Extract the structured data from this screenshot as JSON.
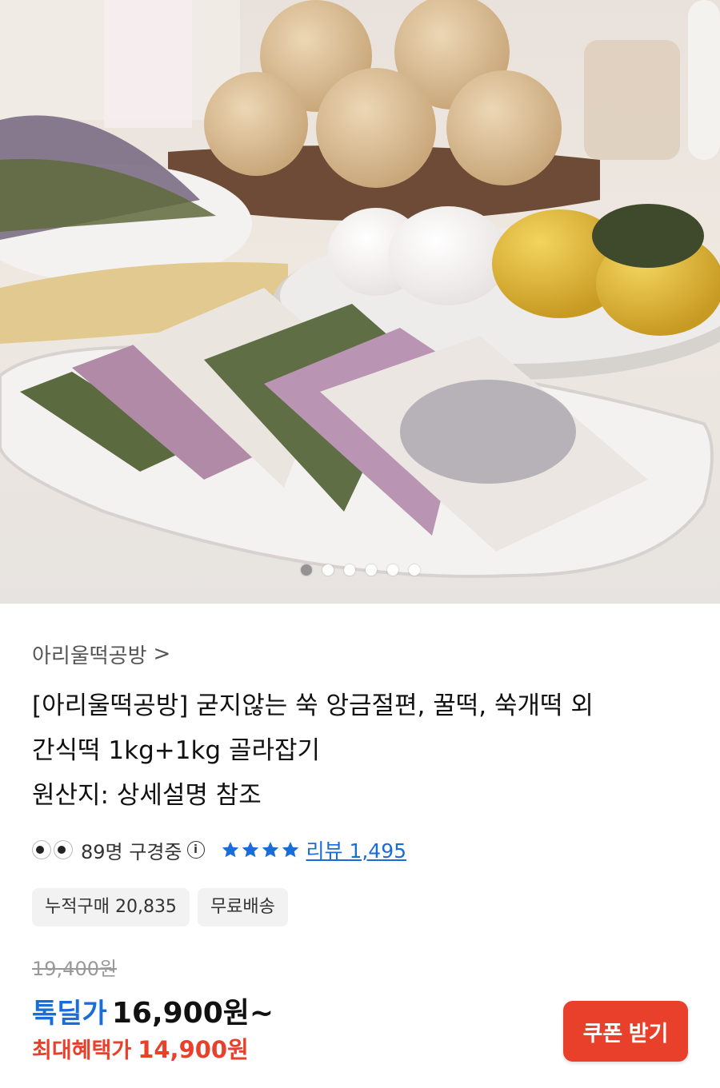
{
  "gallery": {
    "slide_count": 6,
    "active_index": 0
  },
  "seller": {
    "name": "아리울떡공방",
    "chevron": ">"
  },
  "product": {
    "title_line1": "[아리울떡공방] 굳지않는 쑥 앙금절편, 꿀떡, 쑥개떡 외",
    "title_line2": "간식떡 1kg+1kg 골라잡기",
    "origin": "원산지: 상세설명 참조"
  },
  "meta": {
    "watching": "89명 구경중",
    "info_icon": "ⓘ",
    "rating_stars": 4,
    "review_link": "리뷰 1,495"
  },
  "badges": [
    "누적구매 20,835",
    "무료배송"
  ],
  "pricing": {
    "original_price": "19,400원",
    "deal_label": "톡딜가",
    "deal_price": "16,900원~",
    "max_benefit_label": "최대혜택가",
    "max_benefit_price": "14,900원",
    "coupon_button": "쿠폰 받기"
  },
  "colors": {
    "accent_blue": "#1a6dd9",
    "accent_red": "#e8402b"
  }
}
